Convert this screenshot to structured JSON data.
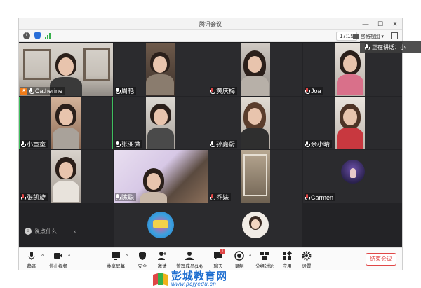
{
  "app": {
    "title": "腾讯会议"
  },
  "window_controls": {
    "minimize": "—",
    "maximize": "☐",
    "close": "✕"
  },
  "infobar": {
    "time": "17:19",
    "view_label": "宫格视图",
    "view_caret": "▾"
  },
  "speaking": {
    "label": "正在讲话：小"
  },
  "participants": [
    {
      "name": "Catherine",
      "host": true,
      "mic": "on"
    },
    {
      "name": "周艳",
      "host": false,
      "mic": "on"
    },
    {
      "name": "黄庆梅",
      "host": false,
      "mic": "muted"
    },
    {
      "name": "Joa",
      "host": false,
      "mic": "muted"
    },
    {
      "name": "小童童",
      "host": false,
      "mic": "on"
    },
    {
      "name": "张亚微",
      "host": false,
      "mic": "on"
    },
    {
      "name": "孙嘉蔚",
      "host": false,
      "mic": "on"
    },
    {
      "name": "余小晴",
      "host": false,
      "mic": "on"
    },
    {
      "name": "张凯旋",
      "host": false,
      "mic": "muted"
    },
    {
      "name": "陈聪",
      "host": false,
      "mic": "on"
    },
    {
      "name": "乔妹",
      "host": false,
      "mic": "muted"
    },
    {
      "name": "Carmen",
      "host": false,
      "mic": "muted"
    }
  ],
  "chat": {
    "placeholder": "说点什么...",
    "collapse": "‹"
  },
  "toolbar": {
    "mute": "静音",
    "stop_video": "停止视频",
    "share_screen": "共享屏幕",
    "security": "安全",
    "invite": "邀请",
    "manage_members": "管理成员(14)",
    "chat": "聊天",
    "chat_badge": "1",
    "record": "录制",
    "breakout": "分组讨论",
    "apps": "应用",
    "settings": "设置",
    "end_meeting": "结束会议",
    "caret": "^"
  },
  "watermark": {
    "name": "彭城教育网",
    "url": "www.pcjyedu.cn"
  },
  "colors": {
    "accent_green": "#3fbf5f",
    "danger_red": "#e04646",
    "host_orange": "#f07c1a",
    "watermark_blue": "#1f6fd0"
  }
}
